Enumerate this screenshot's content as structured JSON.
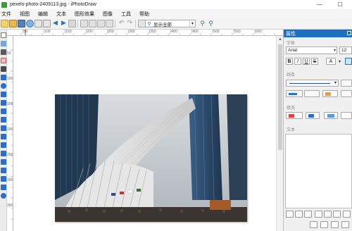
{
  "window": {
    "title": "pexels-photo-2409113.jpg - iPhotoDraw",
    "minimize": "—",
    "maximize": "☐"
  },
  "menu": [
    "文件",
    "视图",
    "编辑",
    "文本",
    "图形效果",
    "图像",
    "工具",
    "帮助"
  ],
  "toolbar": {
    "zoom_value": "显示全部"
  },
  "rulers": {
    "top_labels": [
      "|50",
      "|100",
      "|150",
      "|200",
      "|250",
      "|300",
      "|350",
      "|400",
      "|450",
      "|500",
      "|550",
      "|600"
    ],
    "left_labels": [
      "50",
      "100",
      "150",
      "200",
      "250",
      "300",
      "350"
    ]
  },
  "panel": {
    "title": "属性",
    "font_section": "字体",
    "font_name": "Arial",
    "font_size": "12",
    "bold": "B",
    "italic": "I",
    "underline": "U",
    "strike": "S",
    "font_color": "A",
    "line_section": "线条",
    "fill_section": "填充",
    "text_section": "文本"
  },
  "colors": {
    "accent": "#1f6fbf",
    "titlebar": "#ffffff",
    "panel_bg": "#f0f0f0",
    "canvas_bg": "#ffffff"
  }
}
